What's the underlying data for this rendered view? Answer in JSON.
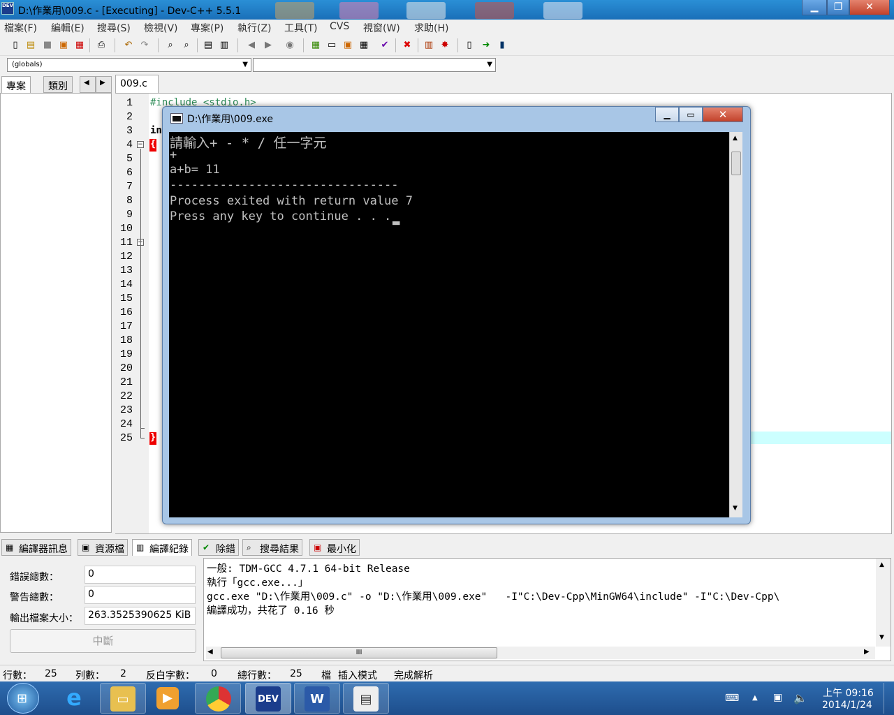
{
  "window": {
    "title": "D:\\作業用\\009.c - [Executing] - Dev-C++ 5.5.1",
    "app_icon": "DEV"
  },
  "menu": [
    "檔案(F)",
    "編輯(E)",
    "搜尋(S)",
    "檢視(V)",
    "專案(P)",
    "執行(Z)",
    "工具(T)",
    "CVS",
    "視窗(W)",
    "求助(H)"
  ],
  "combos": {
    "scope": "(globals)",
    "member": ""
  },
  "left_tabs": [
    "專案",
    "類別"
  ],
  "editor": {
    "tab": "009.c",
    "line_numbers": [
      "1",
      "2",
      "3",
      "4",
      "5",
      "6",
      "7",
      "8",
      "9",
      "10",
      "11",
      "12",
      "13",
      "14",
      "15",
      "16",
      "17",
      "18",
      "19",
      "20",
      "21",
      "22",
      "23",
      "24",
      "25"
    ],
    "line1": "#include <stdio.h>",
    "line3": "in",
    "open_brace": "{",
    "close_brace": "}"
  },
  "console": {
    "title": "D:\\作業用\\009.exe",
    "lines": [
      "請輸入+ - * / 任一字元",
      "+",
      "a+b= 11",
      "--------------------------------",
      "Process exited with return value 7",
      "Press any key to continue . . . "
    ],
    "cursor": "▂"
  },
  "bottom_tabs": [
    {
      "label": "編譯器訊息",
      "icon": "grid-icon"
    },
    {
      "label": "資源檔",
      "icon": "resource-icon"
    },
    {
      "label": "編譯紀錄",
      "icon": "chart-icon"
    },
    {
      "label": "除錯",
      "icon": "check-icon"
    },
    {
      "label": "搜尋結果",
      "icon": "search-icon"
    },
    {
      "label": "最小化",
      "icon": "minimize-icon"
    }
  ],
  "compile_stats": {
    "errors_label": "錯誤總數：",
    "errors": "0",
    "warnings_label": "警告總數：",
    "warnings": "0",
    "size_label": "輸出檔案大小：",
    "size": "263.3525390625 KiB",
    "abort": "中斷"
  },
  "log": [
    "一般: TDM-GCC 4.7.1 64-bit Release",
    "執行「gcc.exe...」",
    "gcc.exe \"D:\\作業用\\009.c\" -o \"D:\\作業用\\009.exe\"   -I\"C:\\Dev-Cpp\\MinGW64\\include\" -I\"C:\\Dev-Cpp\\",
    "編譯成功，共花了 0.16 秒"
  ],
  "hscroll_grip": "III",
  "status": {
    "row_label": "行數：",
    "row": "25",
    "col_label": "列數：",
    "col": "2",
    "sel_label": "反白字數：",
    "sel": "0",
    "total_label": "總行數：",
    "total": "25",
    "mode": "插入模式",
    "parse": "完成解析",
    "mode_prefix": "檔"
  },
  "clock": {
    "time": "上午 09:16",
    "date": "2014/1/24"
  },
  "taskbar_apps": [
    "start",
    "internet-explorer",
    "file-explorer",
    "media-player",
    "chrome",
    "dev-cpp",
    "word",
    "reader"
  ],
  "colors": {
    "brace_bg": "#ee0000",
    "highlight_line": "#ccffff",
    "console_bg": "#000000",
    "console_fg": "#c0c0c0"
  }
}
